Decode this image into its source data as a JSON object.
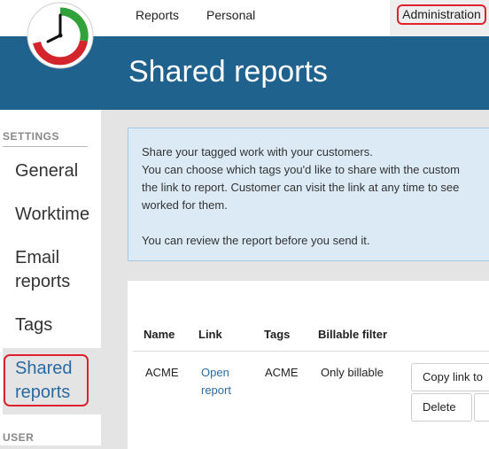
{
  "nav": {
    "reports_label": "Reports",
    "personal_label": "Personal",
    "administration_label": "Administration"
  },
  "page": {
    "title": "Shared reports"
  },
  "sidebar": {
    "settings_heading": "SETTINGS",
    "items": [
      {
        "label": "General"
      },
      {
        "label": "Worktime"
      },
      {
        "label_line1": "Email",
        "label_line2": "reports"
      },
      {
        "label": "Tags"
      },
      {
        "label_line1": "Shared",
        "label_line2": "reports",
        "active": true
      }
    ],
    "user_heading": "USER"
  },
  "info": {
    "lines": [
      "Share your tagged work with your customers.",
      "You can choose which tags you'd like to share with the custom",
      "the link to report. Customer can visit the link at any time to see",
      "worked for them.",
      "",
      "You can review the report before you send it."
    ]
  },
  "table": {
    "headers": {
      "name": "Name",
      "link": "Link",
      "tags": "Tags",
      "billable": "Billable filter"
    },
    "rows": [
      {
        "name": "ACME",
        "link_line1": "Open",
        "link_line2": "report",
        "tags": "ACME",
        "billable": "Only billable",
        "copy_button": "Copy link to",
        "delete_button": "Delete"
      }
    ]
  },
  "colors": {
    "banner": "#20628e",
    "link": "#2a6aa2",
    "highlight": "#e0202e",
    "info_bg": "#dbeaf5"
  },
  "icons": {
    "logo": "clock-logo-icon"
  }
}
